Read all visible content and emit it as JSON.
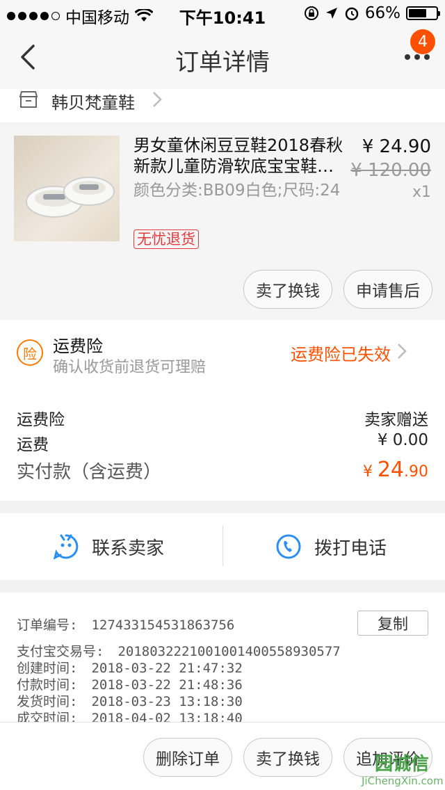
{
  "status_bar": {
    "carrier": "中国移动",
    "time": "下午10:41",
    "battery": "66%",
    "battery_level": 0.66
  },
  "nav": {
    "title": "订单详情",
    "badge_count": "4"
  },
  "shop": {
    "name": "韩贝梵童鞋"
  },
  "product": {
    "title": "男女童休闲豆豆鞋2018春秋新款儿童防滑软底宝宝鞋…",
    "sku": "颜色分类:BB09白色;尺码:24",
    "tag": "无忧退货",
    "price": "¥ 24.90",
    "original_price": "¥ 120.00",
    "quantity": "x1",
    "btn_sell": "卖了换钱",
    "btn_after_sale": "申请售后"
  },
  "insurance": {
    "icon_text": "险",
    "title": "运费险",
    "desc": "确认收货前退货可理赔",
    "status": "运费险已失效"
  },
  "fees": {
    "rows": [
      {
        "label": "运费险",
        "value": "卖家赠送"
      },
      {
        "label": "运费",
        "value": "¥ 0.00"
      }
    ],
    "total_label": "实付款（含运费）",
    "total_currency": "¥ ",
    "total_int": "24",
    "total_dec": ".90"
  },
  "contact": {
    "seller_label": "联系卖家",
    "phone_label": "拨打电话"
  },
  "order_info": {
    "order_no_label": "订单编号:",
    "order_no": "127433154531863756",
    "copy_label": "复制",
    "alipay_label": "支付宝交易号:",
    "alipay_no": "2018032221001001400558930577",
    "created_label": "创建时间:",
    "created": "2018-03-22 21:47:32",
    "paid_label": "付款时间:",
    "paid": "2018-03-22 21:48:36",
    "shipped_label": "发货时间:",
    "shipped": "2018-03-23 13:18:30",
    "completed_label": "成交时间:",
    "completed": "2018-04-02 13:18:40"
  },
  "bottom": {
    "delete_label": "删除订单",
    "sell_label": "卖了换钱",
    "review_label": "追加评价"
  },
  "watermark": {
    "mark": "园诚信",
    "domain": "JiChengXin.com"
  },
  "colors": {
    "accent": "#ff5000",
    "tag_red": "#e4393c",
    "contact_blue": "#2a8ff0"
  }
}
